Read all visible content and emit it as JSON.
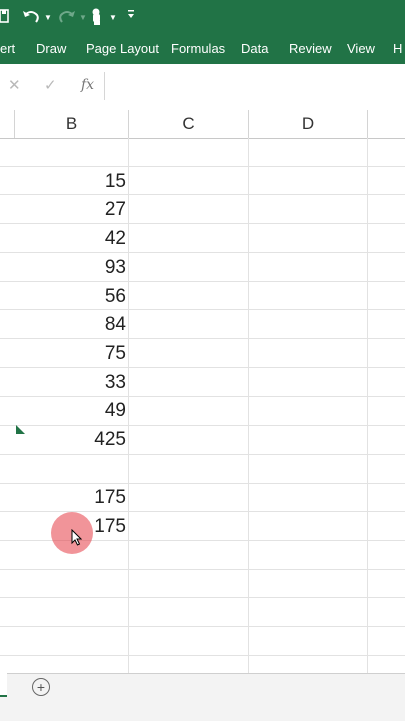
{
  "quick_access": {
    "save_icon": "save-icon",
    "undo_icon": "undo-icon",
    "redo_icon": "redo-icon",
    "touch_icon": "touch-mode-icon",
    "customize_icon": "customize-qat-icon"
  },
  "ribbon": {
    "tabs": [
      "ert",
      "Draw",
      "Page Layout",
      "Formulas",
      "Data",
      "Review",
      "View",
      "H"
    ]
  },
  "formula_bar": {
    "cancel": "✕",
    "enter": "✓",
    "fx": "fx",
    "value": ""
  },
  "columns": [
    "B",
    "C",
    "D"
  ],
  "cells_b": [
    "15",
    "27",
    "42",
    "93",
    "56",
    "84",
    "75",
    "33",
    "49",
    "425",
    "",
    "175",
    "175"
  ],
  "sheet_bar": {
    "add_sheet": "+"
  },
  "colors": {
    "excel_green": "#217346",
    "click_highlight": "#e63c46"
  }
}
